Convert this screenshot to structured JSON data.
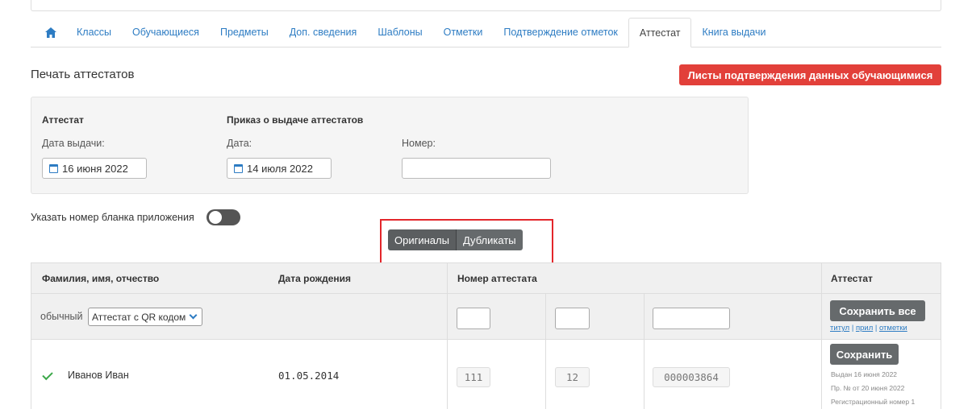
{
  "nav": {
    "home_icon": "home-icon",
    "tabs": [
      {
        "label": "Классы"
      },
      {
        "label": "Обучающиеся"
      },
      {
        "label": "Предметы"
      },
      {
        "label": "Доп. сведения"
      },
      {
        "label": "Шаблоны"
      },
      {
        "label": "Отметки"
      },
      {
        "label": "Подтверждение отметок"
      },
      {
        "label": "Аттестат"
      },
      {
        "label": "Книга выдачи"
      }
    ],
    "active_tab": "Аттестат"
  },
  "page": {
    "title": "Печать аттестатов",
    "confirm_button": "Листы подтверждения данных обучающимися"
  },
  "panel": {
    "attestat_heading": "Аттестат",
    "issue_date_label": "Дата выдачи:",
    "issue_date_value": "16 июня 2022",
    "order_heading": "Приказ о выдаче аттестатов",
    "order_date_label": "Дата:",
    "order_date_value": "14 июля 2022",
    "order_number_label": "Номер:",
    "order_number_value": ""
  },
  "toggle": {
    "label": "Указать номер бланка приложения",
    "on": false
  },
  "segment": {
    "originals": "Оригиналы",
    "duplicates": "Дубликаты"
  },
  "table": {
    "headers": {
      "name": "Фамилия, имя, отчество",
      "birth": "Дата рождения",
      "number": "Номер аттестата",
      "attestat": "Аттестат"
    },
    "filter": {
      "type_label": "обычный",
      "template_selected": "Аттестат с QR кодом",
      "save_all_button": "Сохранить все",
      "links": [
        "титул",
        "прил",
        "отметки"
      ],
      "link_separator": "|"
    },
    "rows": [
      {
        "name": "Иванов Иван",
        "birth_date": "01.05.2014",
        "series": "111",
        "series2": "12",
        "number": "000003864",
        "save_button": "Сохранить",
        "issued": "Выдан 16 июня 2022",
        "order": "Пр. № от 20 июня 2022",
        "reg": "Регистрационный номер 1"
      }
    ]
  },
  "colors": {
    "accent": "#2d7cc3",
    "danger": "#e2403a",
    "button_grey": "#666a6c",
    "check": "#3ca84a",
    "highlight": "#e3262b"
  }
}
